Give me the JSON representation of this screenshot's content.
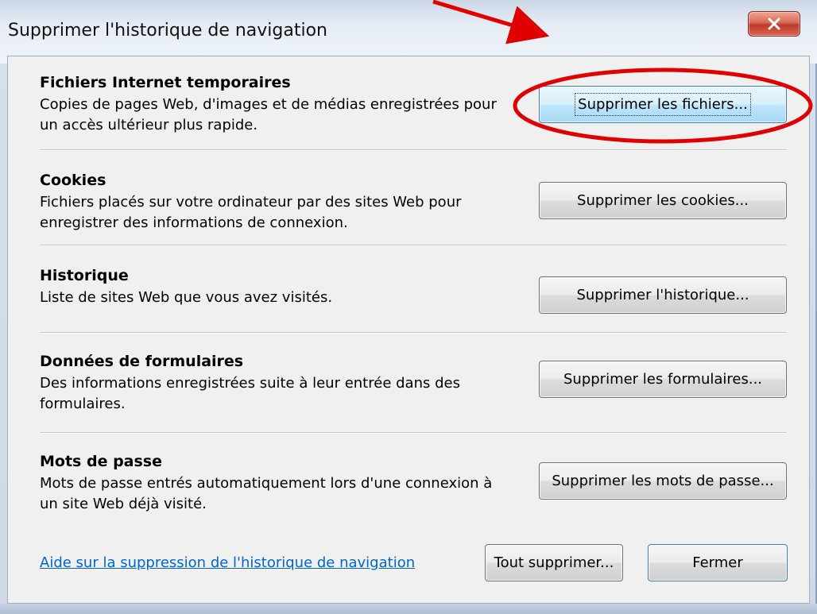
{
  "window": {
    "title": "Supprimer l'historique de navigation",
    "close_icon": "close-icon"
  },
  "sections": [
    {
      "title": "Fichiers Internet temporaires",
      "description": "Copies de pages Web, d'images et de médias enregistrées pour un accès ultérieur plus rapide.",
      "button_label": "Supprimer les fichiers..."
    },
    {
      "title": "Cookies",
      "description": "Fichiers placés sur votre ordinateur par des sites Web pour enregistrer des informations de connexion.",
      "button_label": "Supprimer les cookies..."
    },
    {
      "title": "Historique",
      "description": "Liste de sites Web que vous avez visités.",
      "button_label": "Supprimer l'historique..."
    },
    {
      "title": "Données de formulaires",
      "description": "Des informations enregistrées suite à leur entrée dans des formulaires.",
      "button_label": "Supprimer les formulaires..."
    },
    {
      "title": "Mots de passe",
      "description": "Mots de passe entrés automatiquement lors d'une connexion à un site Web déjà visité.",
      "button_label": "Supprimer les mots de passe..."
    }
  ],
  "footer": {
    "help_link": "Aide sur la suppression de l'historique de navigation",
    "delete_all_label": "Tout supprimer...",
    "close_label": "Fermer"
  },
  "colors": {
    "annotation": "#e00000",
    "link": "#0066cc",
    "focused_button": "#bee6fd"
  }
}
